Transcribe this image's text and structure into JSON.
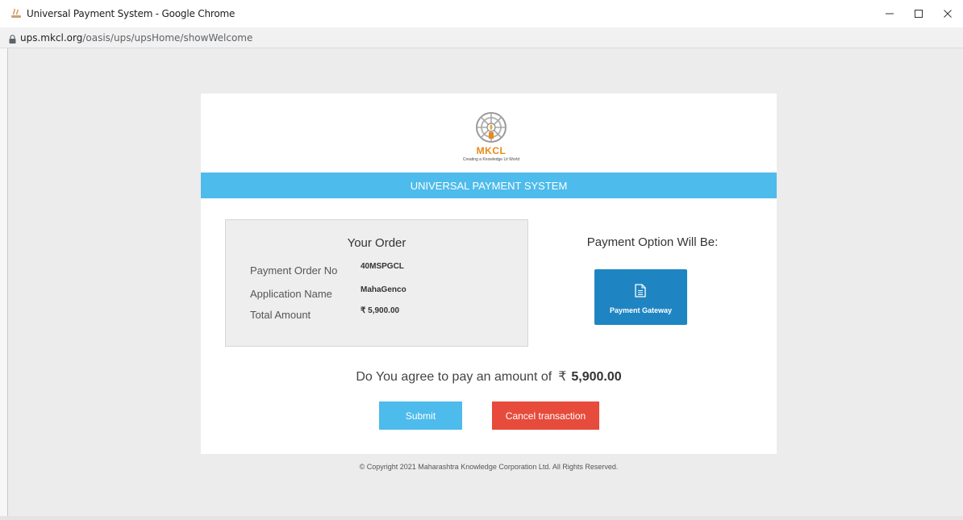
{
  "window": {
    "title": "Universal Payment System - Google Chrome",
    "url_host": "ups.mkcl.org",
    "url_path": "/oasis/ups/upsHome/showWelcome"
  },
  "logo": {
    "name": "MKCL",
    "tagline": "Creating a Knowledge Lit World"
  },
  "banner": {
    "title": "UNIVERSAL PAYMENT SYSTEM"
  },
  "order": {
    "title": "Your Order",
    "rows": [
      {
        "label": "Payment Order No",
        "value": "40MSPGCL"
      },
      {
        "label": "Application Name",
        "value": "MahaGenco"
      },
      {
        "label": "Total Amount",
        "value": "₹  5,900.00"
      }
    ]
  },
  "payment": {
    "heading": "Payment Option Will Be:",
    "gateway_label": "Payment Gateway"
  },
  "agree": {
    "text": "Do You agree to pay an amount of",
    "currency": "₹",
    "amount": "5,900.00"
  },
  "buttons": {
    "submit": "Submit",
    "cancel": "Cancel transaction"
  },
  "footer": {
    "copyright": "© Copyright 2021 Maharashtra Knowledge Corporation Ltd. All Rights Reserved."
  },
  "colors": {
    "banner": "#4dbbeb",
    "gateway": "#1f85c2",
    "submit": "#4dbbeb",
    "cancel": "#e74b3c",
    "logo_accent": "#e8891a"
  }
}
